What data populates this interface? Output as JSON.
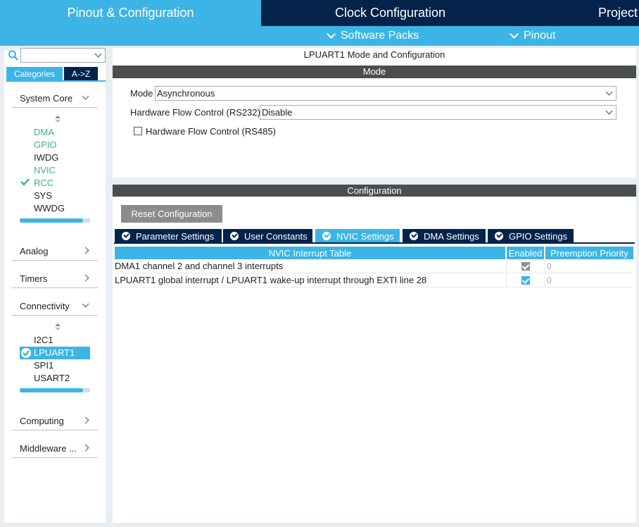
{
  "top_tabs": {
    "pinout": "Pinout & Configuration",
    "clock": "Clock Configuration",
    "project": "Project"
  },
  "sub_bar": {
    "software_packs": "Software Packs",
    "pinout": "Pinout"
  },
  "sidebar": {
    "search_value": "",
    "categories_tab": "Categories",
    "az_tab": "A->Z",
    "system_core": {
      "label": "System Core",
      "items": [
        "DMA",
        "GPIO",
        "IWDG",
        "NVIC",
        "RCC",
        "SYS",
        "WWDG"
      ]
    },
    "analog": "Analog",
    "timers": "Timers",
    "connectivity": {
      "label": "Connectivity",
      "items": [
        "I2C1",
        "LPUART1",
        "SPI1",
        "USART2"
      ]
    },
    "computing": "Computing",
    "middleware": "Middleware ..."
  },
  "mode_panel": {
    "title": "LPUART1 Mode and Configuration",
    "section": "Mode",
    "mode_label": "Mode",
    "mode_value": "Asynchronous",
    "hwfc232_label": "Hardware Flow Control (RS232)",
    "hwfc232_value": "Disable",
    "hwfc485_label": "Hardware Flow Control (RS485)"
  },
  "config_panel": {
    "section": "Configuration",
    "reset_label": "Reset Configuration",
    "tabs": [
      "Parameter Settings",
      "User Constants",
      "NVIC Settings",
      "DMA Settings",
      "GPIO Settings"
    ],
    "active_tab": "NVIC Settings",
    "table": {
      "headers": [
        "NVIC Interrupt Table",
        "Enabled",
        "Preemption Priority"
      ],
      "rows": [
        {
          "name": "DMA1 channel 2 and channel 3 interrupts",
          "enabled": true,
          "locked": true,
          "priority": "0"
        },
        {
          "name": "LPUART1 global interrupt / LPUART1 wake-up interrupt through EXTI line 28",
          "enabled": true,
          "locked": false,
          "priority": "0"
        }
      ]
    }
  },
  "colors": {
    "accent": "#3cb4e6",
    "navy": "#03234b",
    "green": "#3cb47b",
    "section_bar": "#4b4d4f"
  }
}
